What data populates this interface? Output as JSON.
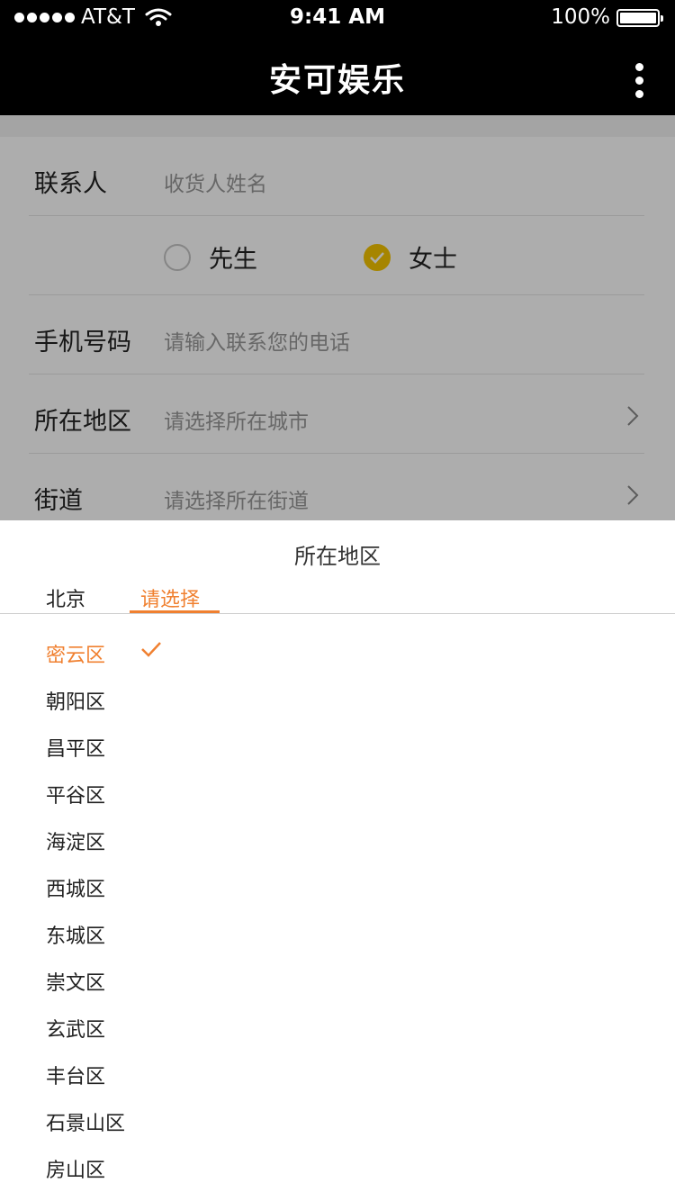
{
  "status_bar": {
    "carrier": "AT&T",
    "time": "9:41 AM",
    "battery": "100%"
  },
  "nav": {
    "title": "安可娱乐"
  },
  "form": {
    "contact_label": "联系人",
    "contact_placeholder": "收货人姓名",
    "gender_options": [
      "先生",
      "女士"
    ],
    "gender_selected": "女士",
    "phone_label": "手机号码",
    "phone_placeholder": "请输入联系您的电话",
    "region_label": "所在地区",
    "region_placeholder": "请选择所在城市",
    "street_label": "街道",
    "street_placeholder": "请选择所在街道"
  },
  "picker": {
    "title": "所在地区",
    "tabs": [
      "北京",
      "请选择"
    ],
    "active_tab": "请选择",
    "districts": [
      "密云区",
      "朝阳区",
      "昌平区",
      "平谷区",
      "海淀区",
      "西城区",
      "东城区",
      "崇文区",
      "玄武区",
      "丰台区",
      "石景山区",
      "房山区"
    ],
    "selected_district": "密云区"
  },
  "colors": {
    "accent": "#f08030",
    "radio_checked": "#f5c400",
    "nav_bg": "#000000"
  }
}
